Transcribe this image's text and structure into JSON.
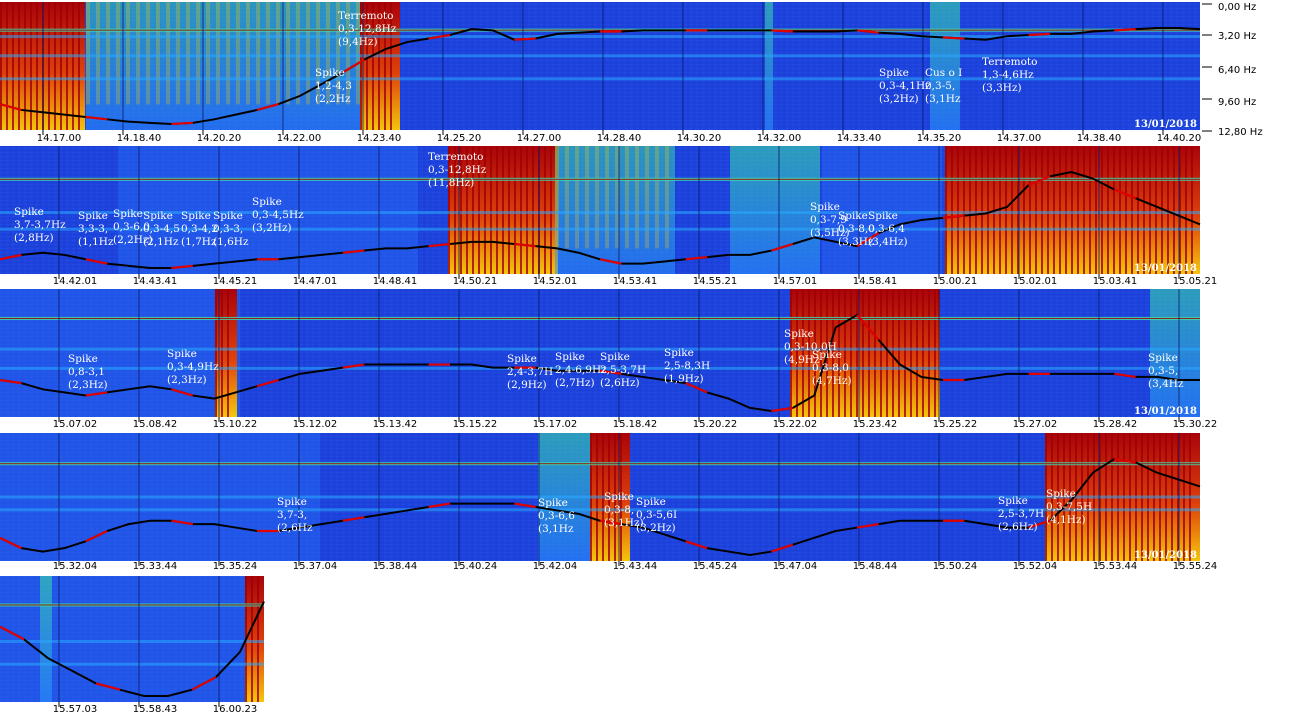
{
  "chart_data": {
    "type": "heatmap",
    "title": "",
    "date": "13/01/2018",
    "frequency_axis": {
      "ticks": [
        "0,00 Hz",
        "3,20 Hz",
        "6,40 Hz",
        "9,60 Hz",
        "12,80 Hz"
      ],
      "values": [
        0.0,
        3.2,
        6.4,
        9.6,
        12.8
      ],
      "ylim": [
        0,
        12.8
      ]
    },
    "colors": {
      "background": "#1a3fd8",
      "line_low": "#29a9ff",
      "line_mid": "#3ce0b0",
      "line_high": "#ffd400",
      "burst": "#a00000",
      "trace": "#000000",
      "trace_highlight": "#e00000"
    },
    "strips": [
      {
        "time_ticks": [
          "14.17.00",
          "14.18.40",
          "14.20.20",
          "14.22.00",
          "14.23.40",
          "14.25.20",
          "14.27.00",
          "14.28.40",
          "14.30.20",
          "14.32.00",
          "14.33.40",
          "14.35.20",
          "14.37.00",
          "14.38.40",
          "14.40.20"
        ],
        "trace": [
          14.5,
          14.0,
          13.8,
          13.6,
          13.4,
          13.2,
          13.0,
          12.9,
          12.8,
          12.9,
          13.2,
          13.6,
          14.0,
          14.5,
          15.2,
          16.2,
          17.2,
          18.3,
          19.2,
          19.8,
          20.1,
          20.4,
          20.9,
          20.8,
          20.0,
          20.1,
          20.5,
          20.6,
          20.7,
          20.7,
          20.8,
          20.8,
          20.8,
          20.8,
          20.8,
          20.8,
          20.8,
          20.7,
          20.7,
          20.7,
          20.8,
          20.6,
          20.5,
          20.3,
          20.2,
          20.1,
          20.0,
          20.3,
          20.4,
          20.5,
          20.5,
          20.7,
          20.8,
          20.9,
          21.0,
          21.0,
          20.9
        ],
        "annotations": [
          {
            "lines": [
              "Terremoto",
              "0,3-12,8Hz",
              "(9,4Hz)"
            ]
          },
          {
            "lines": [
              "Spike",
              "1,2-4,3",
              "(2,2Hz"
            ]
          },
          {
            "lines": [
              "Spike",
              "0,3-4,1Hz",
              "(3,2Hz)"
            ]
          },
          {
            "lines": [
              "Cus o I",
              "0,3-5,",
              "(3,1Hz"
            ]
          },
          {
            "lines": [
              "Terremoto",
              "1,3-4,6Hz",
              "(3,3Hz)"
            ]
          }
        ]
      },
      {
        "time_ticks": [
          "14.42.01",
          "14.43.41",
          "14.45.21",
          "14.47.01",
          "14.48.41",
          "14.50.21",
          "14.52.01",
          "14.53.41",
          "14.55.21",
          "14.57.01",
          "14.58.41",
          "15.00.21",
          "15.02.01",
          "15.03.41",
          "15.05.21"
        ],
        "trace": [
          1.8,
          2.0,
          2.1,
          2.0,
          1.8,
          1.6,
          1.5,
          1.4,
          1.4,
          1.5,
          1.6,
          1.7,
          1.8,
          1.8,
          1.9,
          2.0,
          2.1,
          2.2,
          2.3,
          2.3,
          2.4,
          2.5,
          2.6,
          2.6,
          2.5,
          2.4,
          2.3,
          2.1,
          1.8,
          1.6,
          1.6,
          1.7,
          1.8,
          1.9,
          2.0,
          2.0,
          2.2,
          2.5,
          2.8,
          2.6,
          2.4,
          3.0,
          3.4,
          3.6,
          3.7,
          3.8,
          3.9,
          4.2,
          5.2,
          5.6,
          5.8,
          5.5,
          5.0,
          4.6,
          4.2,
          3.8,
          3.4
        ],
        "annotations": [
          {
            "lines": [
              "Spike",
              "3,7-3,7Hz",
              "(2,8Hz)"
            ]
          },
          {
            "lines": [
              "Spike",
              "3,3-3,",
              "(1,1Hz"
            ]
          },
          {
            "lines": [
              "Spike",
              "0,3-6,0",
              "(2,2Hz)"
            ]
          },
          {
            "lines": [
              "Spike",
              "0,3-4,5",
              "(2,1Hz"
            ]
          },
          {
            "lines": [
              "Spike",
              "0,3-4,2",
              "(1,7Hz"
            ]
          },
          {
            "lines": [
              "Spike",
              "0,3-3,",
              "(1,6Hz"
            ]
          },
          {
            "lines": [
              "Spike",
              "0,3-4,5Hz",
              "(3,2Hz)"
            ]
          },
          {
            "lines": [
              "Terremoto",
              "0,3-12,8Hz",
              "(11,8Hz)"
            ]
          },
          {
            "lines": [
              "Spike",
              "0,3-7,9",
              "(3,5Hz)"
            ]
          },
          {
            "lines": [
              "Spike",
              "0,3-8,0",
              "(3,3Hz"
            ]
          },
          {
            "lines": [
              "Spike",
              "0,3-6,4",
              "(3,4Hz)"
            ]
          }
        ]
      },
      {
        "time_ticks": [
          "15.07.02",
          "15.08.42",
          "15.10.22",
          "15.12.02",
          "15.13.42",
          "15.15.22",
          "15.17.02",
          "15.18.42",
          "15.20.22",
          "15.22.02",
          "15.23.42",
          "15.25.22",
          "15.27.02",
          "15.28.42",
          "15.30.22"
        ],
        "trace": [
          2.3,
          2.2,
          2.0,
          1.9,
          1.8,
          1.9,
          2.0,
          2.1,
          2.0,
          1.8,
          1.7,
          1.9,
          2.1,
          2.3,
          2.5,
          2.6,
          2.7,
          2.8,
          2.8,
          2.8,
          2.8,
          2.8,
          2.8,
          2.7,
          2.7,
          2.7,
          2.6,
          2.6,
          2.6,
          2.5,
          2.4,
          2.3,
          2.2,
          1.9,
          1.7,
          1.4,
          1.3,
          1.4,
          1.8,
          4.0,
          4.4,
          3.6,
          2.8,
          2.4,
          2.3,
          2.3,
          2.4,
          2.5,
          2.5,
          2.5,
          2.5,
          2.5,
          2.5,
          2.4,
          2.4,
          2.3,
          2.3
        ],
        "annotations": [
          {
            "lines": [
              "Spike",
              "0,8-3,1",
              "(2,3Hz)"
            ]
          },
          {
            "lines": [
              "Spike",
              "0,3-4,9Hz",
              "(2,3Hz)"
            ]
          },
          {
            "lines": [
              "Spike",
              "2,4-3,7H",
              "(2,9Hz)"
            ]
          },
          {
            "lines": [
              "Spike",
              "2,4-6,9Hz",
              "(2,7Hz)"
            ]
          },
          {
            "lines": [
              "Spike",
              "2,5-3,7H",
              "(2,6Hz)"
            ]
          },
          {
            "lines": [
              "Spike",
              "2,5-8,3H",
              "(1,9Hz)"
            ]
          },
          {
            "lines": [
              "Spike",
              "0,3-10,0H",
              "(4,9Hz"
            ]
          },
          {
            "lines": [
              "Spike",
              "0,3-8,0",
              "(4,7Hz)"
            ]
          },
          {
            "lines": [
              "Spike",
              "0,3-5,",
              "(3,4Hz"
            ]
          }
        ]
      },
      {
        "time_ticks": [
          "15.32.04",
          "15.33.44",
          "15.35.24",
          "15.37.04",
          "15.38.44",
          "15.40.24",
          "15.42.04",
          "15.43.44",
          "15.45.24",
          "15.47.04",
          "15.48.44",
          "15.50.24",
          "15.52.04",
          "15.53.44",
          "15.55.24"
        ],
        "trace": [
          2.1,
          1.8,
          1.7,
          1.8,
          2.0,
          2.3,
          2.5,
          2.6,
          2.6,
          2.5,
          2.5,
          2.4,
          2.3,
          2.3,
          2.4,
          2.5,
          2.6,
          2.7,
          2.8,
          2.9,
          3.0,
          3.1,
          3.1,
          3.1,
          3.1,
          3.0,
          2.9,
          2.8,
          2.6,
          2.5,
          2.4,
          2.2,
          2.0,
          1.8,
          1.7,
          1.6,
          1.7,
          1.9,
          2.1,
          2.3,
          2.4,
          2.5,
          2.6,
          2.6,
          2.6,
          2.6,
          2.5,
          2.4,
          2.4,
          2.6,
          3.2,
          4.0,
          4.4,
          4.3,
          4.0,
          3.8,
          3.6
        ],
        "annotations": [
          {
            "lines": [
              "Spike",
              "3,7-3,",
              "(2,6Hz"
            ]
          },
          {
            "lines": [
              "Spike",
              "0,3-6,6",
              "(3,1Hz"
            ]
          },
          {
            "lines": [
              "Spike",
              "0,3-8,",
              "(3,1Hz)"
            ]
          },
          {
            "lines": [
              "Spike",
              "0,3-5,6I",
              "(3,2Hz)"
            ]
          },
          {
            "lines": [
              "Spike",
              "2,5-3,7H",
              "(2,6Hz)"
            ]
          },
          {
            "lines": [
              "Spike",
              "0,3-7,5H",
              "(4,1Hz)"
            ]
          }
        ]
      },
      {
        "time_ticks": [
          "15.57.03",
          "15.58.43",
          "16.00.23"
        ],
        "trace": [
          2.6,
          2.4,
          2.1,
          1.9,
          1.7,
          1.6,
          1.5,
          1.5,
          1.6,
          1.8,
          2.2,
          3.0
        ],
        "annotations": []
      }
    ]
  }
}
